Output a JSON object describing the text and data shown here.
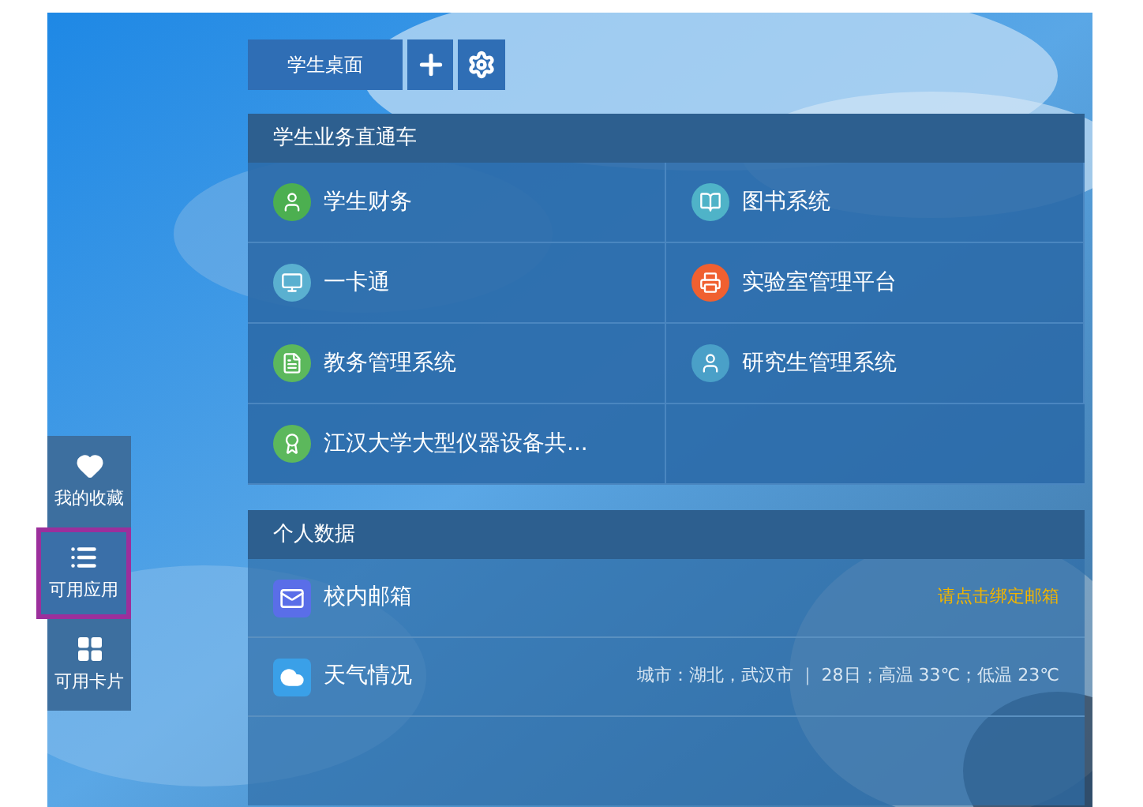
{
  "sidebar": {
    "items": [
      {
        "label": "我的收藏",
        "selected": false
      },
      {
        "label": "可用应用",
        "selected": true
      },
      {
        "label": "可用卡片",
        "selected": false
      }
    ]
  },
  "toolbar": {
    "tab": "学生桌面"
  },
  "services": {
    "title": "学生业务直通车",
    "items": [
      {
        "label": "学生财务",
        "color": "#4caf50"
      },
      {
        "label": "图书系统",
        "color": "#4fb3c8"
      },
      {
        "label": "一卡通",
        "color": "#5ab0d0"
      },
      {
        "label": "实验室管理平台",
        "color": "#f06030"
      },
      {
        "label": "教务管理系统",
        "color": "#5cb85c"
      },
      {
        "label": "研究生管理系统",
        "color": "#4aa0c8"
      },
      {
        "label": "江汉大学大型仪器设备共..."
      }
    ]
  },
  "personal": {
    "title": "个人数据",
    "rows": [
      {
        "kind": "mail",
        "label": "校内邮箱",
        "info": "请点击绑定邮箱",
        "warning": true
      },
      {
        "kind": "weather",
        "label": "天气情况",
        "info": "城市：湖北，武汉市 ｜ 28日；高温 33℃；低温 23℃",
        "warning": false
      }
    ]
  }
}
